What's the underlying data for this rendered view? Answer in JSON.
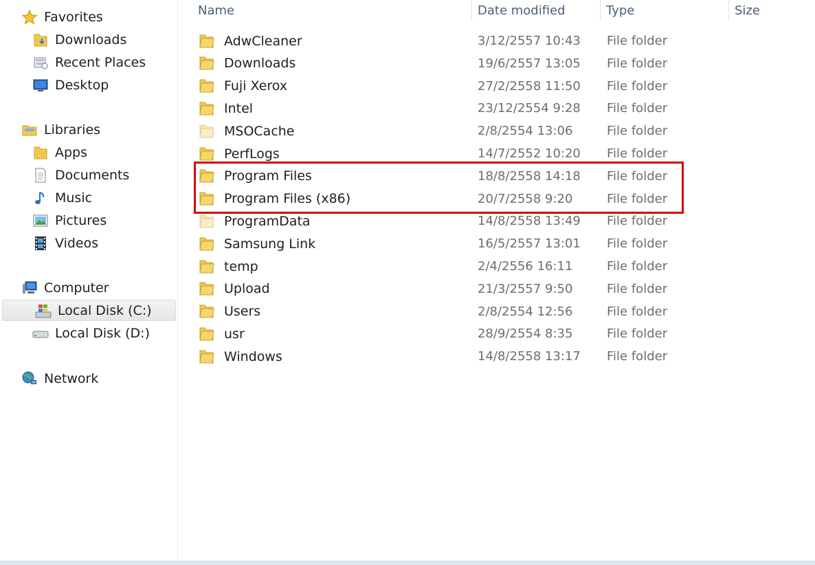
{
  "navigation": {
    "favorites": {
      "label": "Favorites",
      "items": [
        {
          "label": "Downloads",
          "icon": "downloads-folder-icon"
        },
        {
          "label": "Recent Places",
          "icon": "recent-places-icon"
        },
        {
          "label": "Desktop",
          "icon": "desktop-icon"
        }
      ]
    },
    "libraries": {
      "label": "Libraries",
      "items": [
        {
          "label": "Apps",
          "icon": "folder-icon"
        },
        {
          "label": "Documents",
          "icon": "document-icon"
        },
        {
          "label": "Music",
          "icon": "music-note-icon"
        },
        {
          "label": "Pictures",
          "icon": "picture-icon"
        },
        {
          "label": "Videos",
          "icon": "film-icon"
        }
      ]
    },
    "computer": {
      "label": "Computer",
      "items": [
        {
          "label": "Local Disk (C:)",
          "icon": "windows-drive-icon",
          "selected": true
        },
        {
          "label": "Local Disk (D:)",
          "icon": "drive-icon"
        }
      ]
    },
    "network": {
      "label": "Network"
    }
  },
  "columns": {
    "name": "Name",
    "date_modified": "Date modified",
    "type": "Type",
    "size": "Size"
  },
  "files": [
    {
      "name": "AdwCleaner",
      "date": "3/12/2557 10:43",
      "type": "File folder"
    },
    {
      "name": "Downloads",
      "date": "19/6/2557 13:05",
      "type": "File folder"
    },
    {
      "name": "Fuji Xerox",
      "date": "27/2/2558 11:50",
      "type": "File folder"
    },
    {
      "name": "Intel",
      "date": "23/12/2554 9:28",
      "type": "File folder"
    },
    {
      "name": "MSOCache",
      "date": "2/8/2554 13:06",
      "type": "File folder",
      "hidden": true
    },
    {
      "name": "PerfLogs",
      "date": "14/7/2552 10:20",
      "type": "File folder"
    },
    {
      "name": "Program Files",
      "date": "18/8/2558 14:18",
      "type": "File folder"
    },
    {
      "name": "Program Files (x86)",
      "date": "20/7/2558 9:20",
      "type": "File folder"
    },
    {
      "name": "ProgramData",
      "date": "14/8/2558 13:49",
      "type": "File folder",
      "hidden": true
    },
    {
      "name": "Samsung Link",
      "date": "16/5/2557 13:01",
      "type": "File folder"
    },
    {
      "name": "temp",
      "date": "2/4/2556 16:11",
      "type": "File folder"
    },
    {
      "name": "Upload",
      "date": "21/3/2557 9:50",
      "type": "File folder"
    },
    {
      "name": "Users",
      "date": "2/8/2554 12:56",
      "type": "File folder"
    },
    {
      "name": "usr",
      "date": "28/9/2554 8:35",
      "type": "File folder"
    },
    {
      "name": "Windows",
      "date": "14/8/2558 13:17",
      "type": "File folder"
    }
  ],
  "colors": {
    "highlight": "#d40000",
    "folder": "#f2c94c",
    "header_text": "#4c607a"
  }
}
